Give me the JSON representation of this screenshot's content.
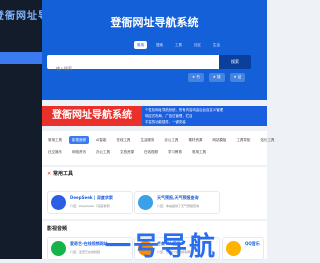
{
  "sidebar": {
    "logo": "登衙网址导航",
    "active_item": ""
  },
  "hero": {
    "title": "登衙网址导航系统",
    "tabs": [
      "常用",
      "搜索",
      "工具",
      "社区",
      "生活"
    ],
    "search_placeholder": "输入搜索",
    "search_button": "搜索",
    "quick_links": [
      "★ 书",
      "★ 搜",
      "★ 站"
    ]
  },
  "banner": {
    "title": "登衙网址导航系统",
    "line1": "个性化网址导航系统，所有内容均由后台自定义管理",
    "line2": "响应式布局，广告位管理，栏目",
    "line3": "丰富的功能插件，一键安装"
  },
  "categories": {
    "row1": [
      "常用工具",
      "影视音频",
      "AI智能",
      "在线工具",
      "生活服务",
      "办公工具",
      "素材资源",
      "网站模板",
      "工具导航",
      "站长工具"
    ],
    "row2": [
      "社交娱乐",
      "网络资讯",
      "办公工具",
      "文档资源",
      "在线视频",
      "学习教育",
      "常用工具"
    ]
  },
  "sections": {
    "common_tools": {
      "title": "常用工具",
      "cards": [
        {
          "name": "DeepSeek | 深度求索",
          "desc": "介绍：DeepSeek（深度求索）",
          "color": "#2c5de5"
        },
        {
          "name": "天气预报,天气预报查询",
          "desc": "介绍：本站提供了天气预报查询",
          "color": "#3aa0e8"
        }
      ]
    },
    "media": {
      "title": "影视音频",
      "cards": [
        {
          "name": "爱奇艺-在线视频网站",
          "desc": "介绍：爱奇艺在线视频",
          "color": "#16b34a"
        },
        {
          "name": "芒果TV-视频",
          "desc": "介绍：芒果TV在线视频网站",
          "color": "#ff8a00"
        },
        {
          "name": "QQ音乐",
          "desc": "",
          "color": "#ffb400"
        }
      ]
    }
  },
  "watermark": "一号导航"
}
